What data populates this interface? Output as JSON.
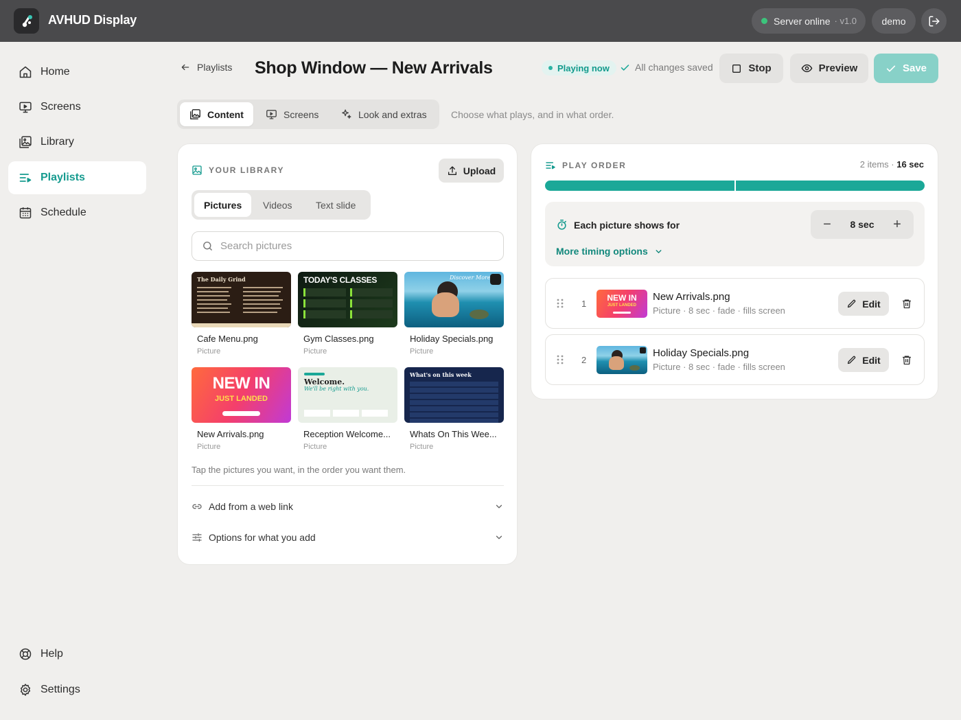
{
  "app": {
    "title": "AVHUD Display",
    "server_status": "Server online",
    "version": "· v1.0",
    "user": "demo"
  },
  "nav": {
    "items": [
      {
        "label": "Home",
        "icon": "home-icon"
      },
      {
        "label": "Screens",
        "icon": "screen-icon"
      },
      {
        "label": "Library",
        "icon": "library-icon"
      },
      {
        "label": "Playlists",
        "icon": "playlist-icon",
        "active": true
      },
      {
        "label": "Schedule",
        "icon": "calendar-icon"
      }
    ],
    "bottom": [
      {
        "label": "Help",
        "icon": "lifebuoy-icon"
      },
      {
        "label": "Settings",
        "icon": "gear-icon"
      }
    ]
  },
  "header": {
    "back_label": "Playlists",
    "title": "Shop Window — New Arrivals",
    "playing_badge": "Playing now",
    "saved_status": "All changes saved",
    "stop_label": "Stop",
    "preview_label": "Preview",
    "save_label": "Save"
  },
  "tabs": {
    "items": [
      "Content",
      "Screens",
      "Look and extras"
    ],
    "active": "Content",
    "hint": "Choose what plays, and in what order."
  },
  "library": {
    "section_title": "YOUR LIBRARY",
    "upload_label": "Upload",
    "subtabs": [
      "Pictures",
      "Videos",
      "Text slide"
    ],
    "search_placeholder": "Search pictures",
    "tiles": [
      {
        "name": "Cafe Menu.png",
        "type": "Picture",
        "thumb_title": "The Daily Grind"
      },
      {
        "name": "Gym Classes.png",
        "type": "Picture",
        "thumb_title": "TODAY'S CLASSES"
      },
      {
        "name": "Holiday Specials.png",
        "type": "Picture",
        "thumb_title": "Discover More"
      },
      {
        "name": "New Arrivals.png",
        "type": "Picture",
        "thumb_title": "NEW IN",
        "thumb_sub": "JUST LANDED"
      },
      {
        "name": "Reception Welcome...",
        "type": "Picture",
        "thumb_title": "Welcome.",
        "thumb_sub": "We'll be right with you."
      },
      {
        "name": "Whats On This Wee...",
        "type": "Picture",
        "thumb_title": "What's on this week"
      }
    ],
    "hint": "Tap the pictures you want, in the order you want them.",
    "web_link_label": "Add from a web link",
    "options_label": "Options for what you add"
  },
  "play_order": {
    "section_title": "PLAY ORDER",
    "count": "2 items ·",
    "total": "16 sec",
    "segments": [
      1,
      1
    ],
    "timing_label": "Each picture shows for",
    "duration": "8 sec",
    "more_timing": "More timing options",
    "edit_label": "Edit",
    "items": [
      {
        "index": "1",
        "name": "New Arrivals.png",
        "meta": "Picture · 8 sec · fade · fills screen",
        "thumb_title": "NEW IN",
        "thumb_sub": "JUST LANDED"
      },
      {
        "index": "2",
        "name": "Holiday Specials.png",
        "meta": "Picture · 8 sec · fade · fills screen"
      }
    ]
  },
  "colors": {
    "accent": "#169b8f",
    "topbar": "#4a4a4c",
    "save": "#88d1c8",
    "progress": "#1ba898"
  }
}
